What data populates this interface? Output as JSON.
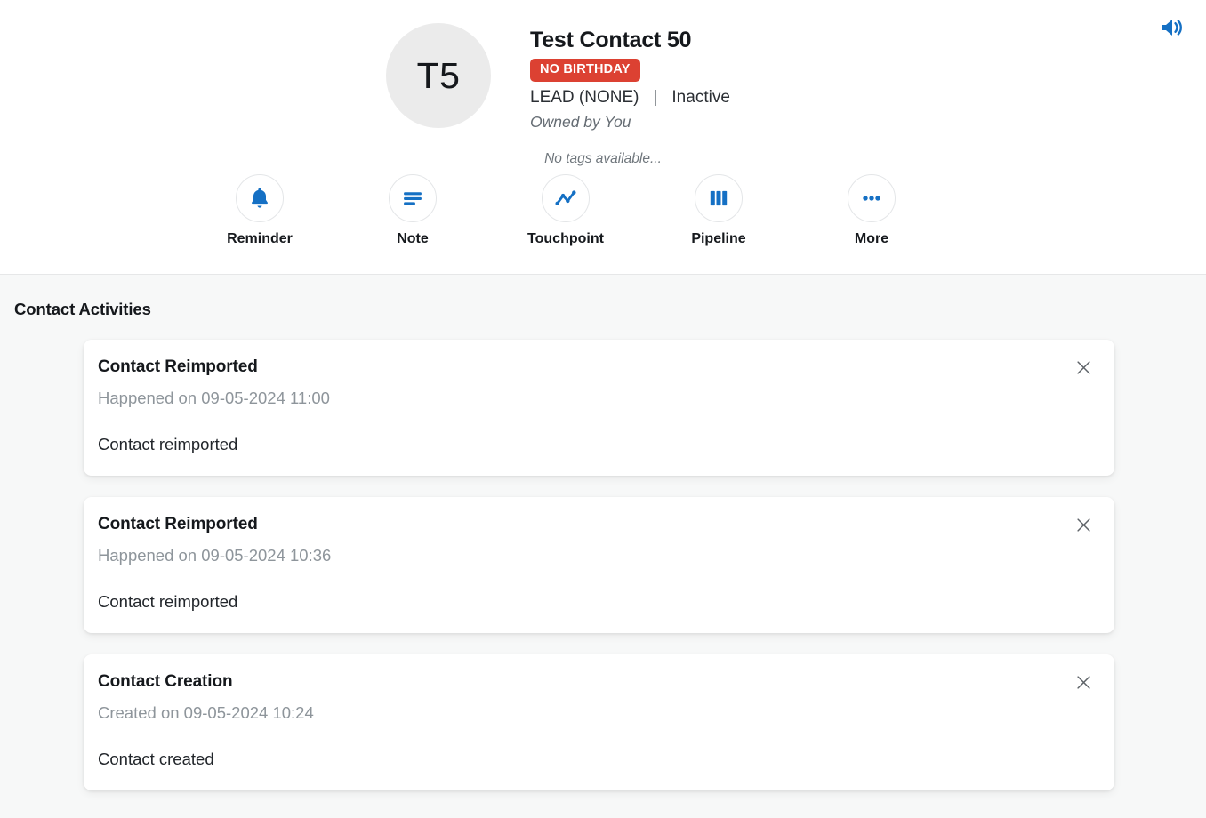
{
  "header": {
    "speaker_icon": "speaker-volume-icon",
    "avatar_initials": "T5",
    "contact_name": "Test Contact 50",
    "badge_label": "NO BIRTHDAY",
    "badge_color": "#dc4132",
    "stage_label": "LEAD (NONE)",
    "meta_separator": "|",
    "status_label": "Inactive",
    "owned_by": "Owned by You",
    "tags_placeholder": "No tags available..."
  },
  "actions": [
    {
      "label": "Reminder",
      "icon": "bell-icon"
    },
    {
      "label": "Note",
      "icon": "note-lines-icon"
    },
    {
      "label": "Touchpoint",
      "icon": "line-chart-icon"
    },
    {
      "label": "Pipeline",
      "icon": "pipeline-bars-icon"
    },
    {
      "label": "More",
      "icon": "ellipsis-icon"
    }
  ],
  "activities_section": {
    "title": "Contact Activities",
    "close_icon": "close-icon",
    "items": [
      {
        "title": "Contact Reimported",
        "subtitle": "Happened on 09-05-2024 11:00",
        "body": "Contact reimported"
      },
      {
        "title": "Contact Reimported",
        "subtitle": "Happened on 09-05-2024 10:36",
        "body": "Contact reimported"
      },
      {
        "title": "Contact Creation",
        "subtitle": "Created on 09-05-2024 10:24",
        "body": "Contact created"
      }
    ]
  },
  "theme": {
    "accent_blue": "#1570c4",
    "page_background": "#f7f8f8",
    "card_background": "#ffffff",
    "avatar_background": "#ebebeb"
  }
}
